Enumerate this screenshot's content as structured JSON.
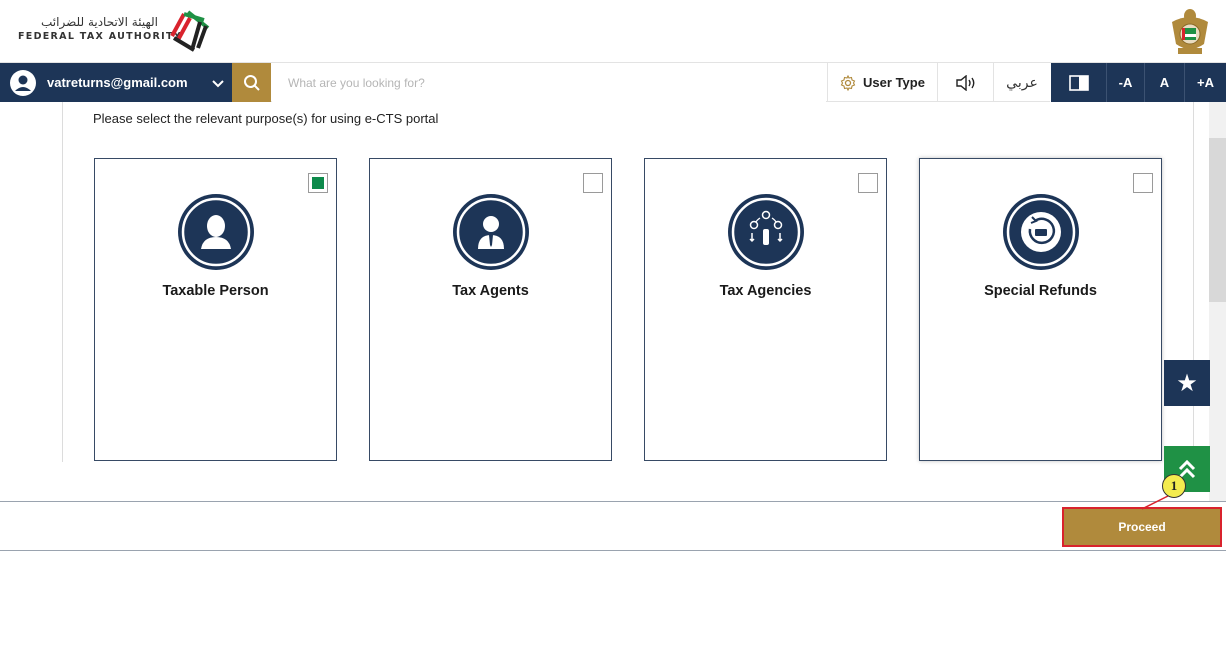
{
  "header": {
    "logo_arabic": "الهيئة الاتحادية للضرائب",
    "logo_english": "FEDERAL TAX AUTHORITY"
  },
  "toolbar": {
    "user_email": "vatreturns@gmail.com",
    "search_placeholder": "What are you looking for?",
    "user_type_label": "User Type",
    "language_label": "عربي",
    "font_decrease_label": "-A",
    "font_normal_label": "A",
    "font_increase_label": "+A"
  },
  "main": {
    "prompt": "Please select the relevant purpose(s) for using e-CTS portal",
    "cards": [
      {
        "label": "Taxable Person",
        "icon": "person-icon",
        "checked": true
      },
      {
        "label": "Tax Agents",
        "icon": "agent-icon",
        "checked": false
      },
      {
        "label": "Tax Agencies",
        "icon": "agencies-icon",
        "checked": false
      },
      {
        "label": "Special Refunds",
        "icon": "refund-icon",
        "checked": false
      }
    ]
  },
  "footer": {
    "proceed_label": "Proceed"
  },
  "annotation": {
    "callout_number": "1"
  },
  "colors": {
    "navy": "#1d3557",
    "gold": "#b08a3c",
    "green_check": "#0d8a4b",
    "green_button": "#1f9145",
    "highlight_red": "#d9232d",
    "callout_yellow": "#f4ec4f"
  }
}
